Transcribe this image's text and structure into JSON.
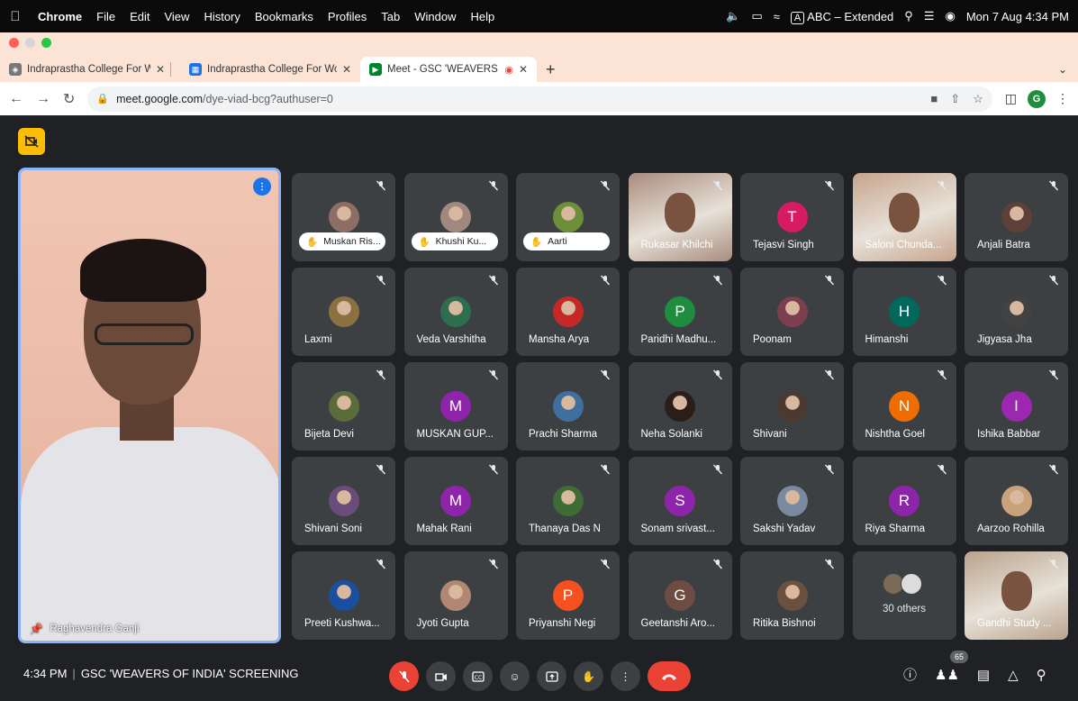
{
  "menubar": {
    "app": "Chrome",
    "items": [
      "File",
      "Edit",
      "View",
      "History",
      "Bookmarks",
      "Profiles",
      "Tab",
      "Window",
      "Help"
    ],
    "input_source": "ABC – Extended",
    "input_glyph": "A",
    "clock": "Mon 7 Aug  4:34 PM"
  },
  "browser": {
    "tabs": [
      {
        "title": "Indraprastha College For Wome",
        "active": false
      },
      {
        "title": "Indraprastha College For Wome",
        "active": false
      },
      {
        "title": "Meet - GSC 'WEAVERS OF",
        "active": true
      }
    ],
    "url_host": "meet.google.com",
    "url_path": "/dye-viad-bcg?authuser=0",
    "profile_initial": "G"
  },
  "meet": {
    "speaker_name": "Raghavendra Ganji",
    "meeting_time": "4:34 PM",
    "meeting_title": "GSC 'WEAVERS OF INDIA' SCREENING",
    "participants_count": "65",
    "tiles": [
      {
        "name": "Muskan Ris...",
        "kind": "chip",
        "color": "#8d6e63"
      },
      {
        "name": "Khushi Ku...",
        "kind": "chip",
        "color": "#a1887f"
      },
      {
        "name": "Aarti",
        "kind": "chip",
        "color": "#6d8f3a"
      },
      {
        "name": "Rukasar Khilchi",
        "kind": "video",
        "color": "#a98c7d"
      },
      {
        "name": "Tejasvi Singh",
        "kind": "letter",
        "letter": "T",
        "color": "#d81b60"
      },
      {
        "name": "Saloni Chunda...",
        "kind": "video",
        "color": "#c7a48c"
      },
      {
        "name": "Anjali Batra",
        "kind": "photo",
        "color": "#5d4037"
      },
      {
        "name": "Laxmi",
        "kind": "photo",
        "color": "#8b7040"
      },
      {
        "name": "Veda Varshitha",
        "kind": "photo",
        "color": "#2e6e4e"
      },
      {
        "name": "Mansha Arya",
        "kind": "photo",
        "color": "#c62828"
      },
      {
        "name": "Paridhi Madhu...",
        "kind": "letter",
        "letter": "P",
        "color": "#1e8e3e"
      },
      {
        "name": "Poonam",
        "kind": "photo",
        "color": "#7b3f4f"
      },
      {
        "name": "Himanshi",
        "kind": "letter",
        "letter": "H",
        "color": "#00695c"
      },
      {
        "name": "Jigyasa Jha",
        "kind": "photo",
        "color": "#424242"
      },
      {
        "name": "Bijeta Devi",
        "kind": "photo",
        "color": "#5b6b3a"
      },
      {
        "name": "MUSKAN GUP...",
        "kind": "letter",
        "letter": "M",
        "color": "#8e24aa"
      },
      {
        "name": "Prachi Sharma",
        "kind": "photo",
        "color": "#3e6f9e"
      },
      {
        "name": "Neha Solanki",
        "kind": "photo",
        "color": "#2b1d18"
      },
      {
        "name": "Shivani",
        "kind": "photo",
        "color": "#4a3a32"
      },
      {
        "name": "Nishtha Goel",
        "kind": "letter",
        "letter": "N",
        "color": "#ef6c00"
      },
      {
        "name": "Ishika Babbar",
        "kind": "letter",
        "letter": "I",
        "color": "#9c27b0"
      },
      {
        "name": "Shivani Soni",
        "kind": "photo",
        "color": "#6a4c7a"
      },
      {
        "name": "Mahak Rani",
        "kind": "letter",
        "letter": "M",
        "color": "#8e24aa"
      },
      {
        "name": "Thanaya Das N",
        "kind": "photo",
        "color": "#3f6b35"
      },
      {
        "name": "Sonam srivast...",
        "kind": "letter",
        "letter": "S",
        "color": "#8e24aa"
      },
      {
        "name": "Sakshi Yadav",
        "kind": "photo",
        "color": "#7a8aa0"
      },
      {
        "name": "Riya Sharma",
        "kind": "letter",
        "letter": "R",
        "color": "#8e24aa"
      },
      {
        "name": "Aarzoo Rohilla",
        "kind": "photo",
        "color": "#c9a27c"
      },
      {
        "name": "Preeti Kushwa...",
        "kind": "photo",
        "color": "#1a4fa0"
      },
      {
        "name": "Jyoti Gupta",
        "kind": "photo",
        "color": "#b08770"
      },
      {
        "name": "Priyanshi Negi",
        "kind": "letter",
        "letter": "P",
        "color": "#f4511e"
      },
      {
        "name": "Geetanshi Aro...",
        "kind": "letter",
        "letter": "G",
        "color": "#6d4c41"
      },
      {
        "name": "Ritika Bishnoi",
        "kind": "photo",
        "color": "#6b5040"
      },
      {
        "name": "30 others",
        "kind": "others",
        "color": "#9e9e9e"
      },
      {
        "name": "Gandhi Study ...",
        "kind": "video",
        "color": "#b9a38c"
      }
    ]
  },
  "colors": {
    "accent_blue": "#8ab4f8",
    "end_call_red": "#ea4335",
    "tile_bg": "#3c4043",
    "meet_bg": "#202124"
  }
}
